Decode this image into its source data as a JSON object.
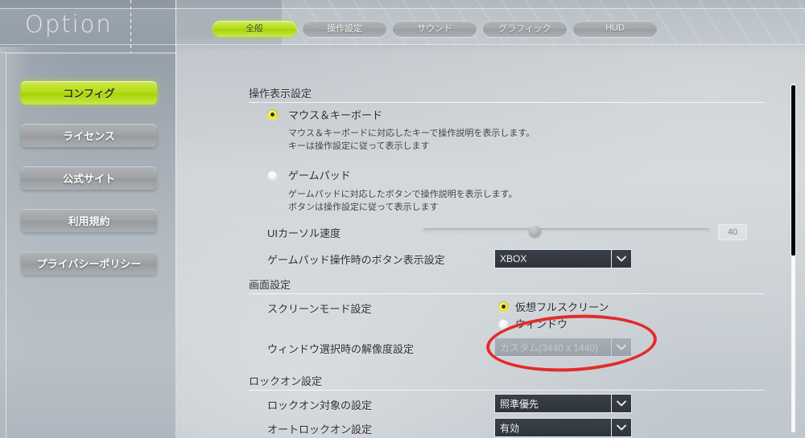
{
  "header": {
    "title": "Option",
    "tabs": [
      {
        "label": "全般",
        "active": true
      },
      {
        "label": "操作設定",
        "active": false
      },
      {
        "label": "サウンド",
        "active": false
      },
      {
        "label": "グラフィック",
        "active": false
      },
      {
        "label": "HUD",
        "active": false
      }
    ]
  },
  "sidebar": {
    "items": [
      {
        "label": "コンフィグ",
        "active": true
      },
      {
        "label": "ライセンス",
        "active": false
      },
      {
        "label": "公式サイト",
        "active": false
      },
      {
        "label": "利用規約",
        "active": false
      },
      {
        "label": "プライバシーポリシー",
        "active": false
      }
    ]
  },
  "sections": {
    "controls_display": {
      "heading": "操作表示設定",
      "radio_mouse_keyboard": {
        "label": "マウス＆キーボード",
        "selected": true,
        "desc_line1": "マウス＆キーボードに対応したキーで操作説明を表示します。",
        "desc_line2": "キーは操作設定に従って表示します"
      },
      "radio_gamepad": {
        "label": "ゲームパッド",
        "selected": false,
        "desc_line1": "ゲームパッドに対応したボタンで操作説明を表示します。",
        "desc_line2": "ボタンは操作設定に従って表示します"
      },
      "ui_cursor_speed": {
        "label": "UIカーソル速度",
        "value": "40",
        "percent": 38
      },
      "gamepad_button_display": {
        "label": "ゲームパッド操作時のボタン表示設定",
        "value": "XBOX"
      }
    },
    "screen": {
      "heading": "画面設定",
      "screen_mode": {
        "label": "スクリーンモード設定",
        "option_virtual_fullscreen": "仮想フルスクリーン",
        "option_window": "ウィンドウ",
        "selected": "仮想フルスクリーン"
      },
      "window_resolution": {
        "label": "ウィンドウ選択時の解像度設定",
        "value": "カスタム(3440 x 1440)",
        "disabled": true
      }
    },
    "lockon": {
      "heading": "ロックオン設定",
      "lockon_target": {
        "label": "ロックオン対象の設定",
        "value": "照準優先"
      },
      "auto_lockon": {
        "label": "オートロックオン設定",
        "value": "有効"
      }
    }
  },
  "annotation": {
    "shape": "ellipse",
    "color": "#e32b29"
  },
  "colors": {
    "accent_green": "#b5db1c",
    "radio_selected_yellow": "#f6ef3c",
    "dropdown_dark": "#333943",
    "annotation_red": "#e32b29"
  }
}
